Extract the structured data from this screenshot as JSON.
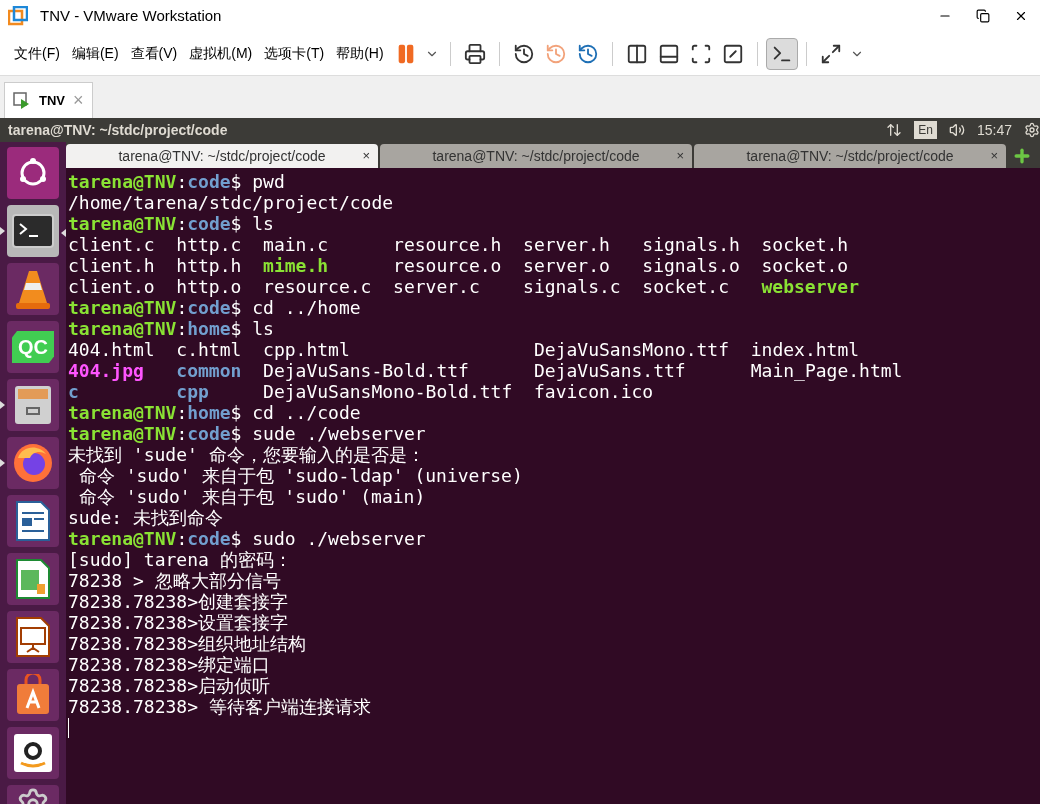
{
  "window": {
    "title": "TNV - VMware Workstation"
  },
  "menu": [
    {
      "label": "文件(F)"
    },
    {
      "label": "编辑(E)"
    },
    {
      "label": "查看(V)"
    },
    {
      "label": "虚拟机(M)"
    },
    {
      "label": "选项卡(T)"
    },
    {
      "label": "帮助(H)"
    }
  ],
  "toolbar": [
    {
      "kind": "pause",
      "pressed": false
    },
    {
      "kind": "caret",
      "pressed": false
    },
    {
      "kind": "sep"
    },
    {
      "kind": "send",
      "pressed": false
    },
    {
      "kind": "sep"
    },
    {
      "kind": "snap-take",
      "pressed": false
    },
    {
      "kind": "snap-revert",
      "pressed": false
    },
    {
      "kind": "snap-manage",
      "pressed": false
    },
    {
      "kind": "sep"
    },
    {
      "kind": "library",
      "pressed": false
    },
    {
      "kind": "thumb",
      "pressed": false
    },
    {
      "kind": "full",
      "pressed": false
    },
    {
      "kind": "unity",
      "pressed": false
    },
    {
      "kind": "sep"
    },
    {
      "kind": "console",
      "pressed": true
    },
    {
      "kind": "sep"
    },
    {
      "kind": "stretch",
      "pressed": false
    },
    {
      "kind": "caret",
      "pressed": false
    }
  ],
  "vm_tabs": [
    {
      "label": "TNV",
      "selected": true,
      "close": "×"
    }
  ],
  "top_bar": {
    "title": "tarena@TNV: ~/stdc/project/code",
    "keyboard": "En",
    "time": "15:47"
  },
  "launcher": [
    {
      "kind": "ubuntu",
      "running": false,
      "active": false
    },
    {
      "kind": "terminal",
      "running": true,
      "active": true
    },
    {
      "kind": "vlc",
      "running": false,
      "active": false
    },
    {
      "kind": "qc",
      "label": "QC",
      "running": false,
      "active": false
    },
    {
      "kind": "files",
      "running": true,
      "active": false
    },
    {
      "kind": "firefox",
      "running": true,
      "active": false
    },
    {
      "kind": "writer",
      "running": false,
      "active": false
    },
    {
      "kind": "calc",
      "running": false,
      "active": false
    },
    {
      "kind": "impress",
      "running": false,
      "active": false
    },
    {
      "kind": "store",
      "running": false,
      "active": false
    },
    {
      "kind": "amazon",
      "running": false,
      "active": false
    },
    {
      "kind": "settings"
    }
  ],
  "terminal_tabs": [
    {
      "label": "tarena@TNV: ~/stdc/project/code",
      "selected": true,
      "close": "×"
    },
    {
      "label": "tarena@TNV: ~/stdc/project/code",
      "selected": false,
      "close": "×"
    },
    {
      "label": "tarena@TNV: ~/stdc/project/code",
      "selected": false,
      "close": "×"
    }
  ],
  "terminal": [
    {
      "kind": "prompt",
      "user": "tarena@TNV",
      "sep": ":",
      "path": "code",
      "cmd": "$ pwd"
    },
    {
      "kind": "text",
      "text": "/home/tarena/stdc/project/code"
    },
    {
      "kind": "prompt",
      "user": "tarena@TNV",
      "sep": ":",
      "path": "code",
      "cmd": "$ ls"
    },
    {
      "kind": "listing",
      "rows": [
        [
          {
            "text": "client.c",
            "kind": "file"
          },
          {
            "text": "http.c",
            "kind": "file"
          },
          {
            "text": "main.c",
            "kind": "file"
          },
          {
            "text": "resource.h",
            "kind": "file"
          },
          {
            "text": "server.h",
            "kind": "file"
          },
          {
            "text": "signals.h",
            "kind": "file"
          },
          {
            "text": "socket.h",
            "kind": "file"
          }
        ],
        [
          {
            "text": "client.h",
            "kind": "file"
          },
          {
            "text": "http.h",
            "kind": "file"
          },
          {
            "text": "mime.h",
            "kind": "exec"
          },
          {
            "text": "resource.o",
            "kind": "file"
          },
          {
            "text": "server.o",
            "kind": "file"
          },
          {
            "text": "signals.o",
            "kind": "file"
          },
          {
            "text": "socket.o",
            "kind": "file"
          }
        ],
        [
          {
            "text": "client.o",
            "kind": "file"
          },
          {
            "text": "http.o",
            "kind": "file"
          },
          {
            "text": "resource.c",
            "kind": "file"
          },
          {
            "text": "server.c",
            "kind": "file"
          },
          {
            "text": "signals.c",
            "kind": "file"
          },
          {
            "text": "socket.c",
            "kind": "file"
          },
          {
            "text": "webserver",
            "kind": "exec"
          }
        ]
      ]
    },
    {
      "kind": "prompt",
      "user": "tarena@TNV",
      "sep": ":",
      "path": "code",
      "cmd": "$ cd ../home"
    },
    {
      "kind": "prompt",
      "user": "tarena@TNV",
      "sep": ":",
      "path": "home",
      "cmd": "$ ls"
    },
    {
      "kind": "listing",
      "rows": [
        [
          {
            "text": "404.html",
            "kind": "file"
          },
          {
            "text": "c.html",
            "kind": "file"
          },
          {
            "text": "cpp.html",
            "kind": "file"
          },
          {
            "text": "DejaVuSansMono.ttf",
            "kind": "file"
          },
          {
            "text": "index.html",
            "kind": "file"
          }
        ],
        [
          {
            "text": "404.jpg",
            "kind": "image"
          },
          {
            "text": "common",
            "kind": "dir"
          },
          {
            "text": "DejaVuSans-Bold.ttf",
            "kind": "file"
          },
          {
            "text": "DejaVuSans.ttf",
            "kind": "file"
          },
          {
            "text": "Main_Page.html",
            "kind": "file"
          }
        ],
        [
          {
            "text": "c",
            "kind": "dir"
          },
          {
            "text": "cpp",
            "kind": "dir"
          },
          {
            "text": "DejaVuSansMono-Bold.ttf",
            "kind": "file"
          },
          {
            "text": "favicon.ico",
            "kind": "file"
          }
        ]
      ]
    },
    {
      "kind": "prompt",
      "user": "tarena@TNV",
      "sep": ":",
      "path": "home",
      "cmd": "$ cd ../code"
    },
    {
      "kind": "prompt",
      "user": "tarena@TNV",
      "sep": ":",
      "path": "code",
      "cmd": "$ sude ./webserver"
    },
    {
      "kind": "text",
      "text": "未找到 'sude' 命令，您要输入的是否是："
    },
    {
      "kind": "text",
      "text": " 命令 'sudo' 来自于包 'sudo-ldap' (universe)"
    },
    {
      "kind": "text",
      "text": " 命令 'sudo' 来自于包 'sudo' (main)"
    },
    {
      "kind": "text",
      "text": "sude: 未找到命令"
    },
    {
      "kind": "prompt",
      "user": "tarena@TNV",
      "sep": ":",
      "path": "code",
      "cmd": "$ sudo ./webserver"
    },
    {
      "kind": "text",
      "text": "[sudo] tarena 的密码："
    },
    {
      "kind": "text",
      "text": "78238 > 忽略大部分信号"
    },
    {
      "kind": "text",
      "text": "78238.78238>创建套接字"
    },
    {
      "kind": "text",
      "text": "78238.78238>设置套接字"
    },
    {
      "kind": "text",
      "text": "78238.78238>组织地址结构"
    },
    {
      "kind": "text",
      "text": "78238.78238>绑定端口"
    },
    {
      "kind": "text",
      "text": "78238.78238>启动侦听"
    },
    {
      "kind": "text",
      "text": "78238.78238> 等待客户端连接请求"
    },
    {
      "kind": "cursor"
    }
  ]
}
